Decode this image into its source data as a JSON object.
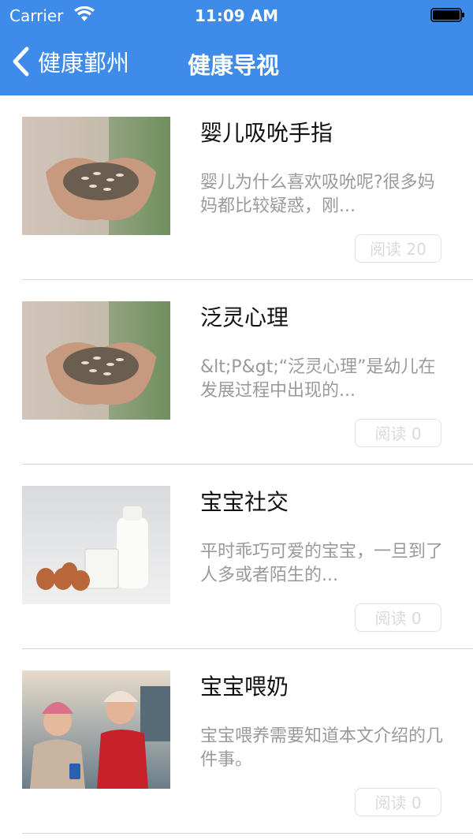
{
  "status_bar": {
    "carrier": "Carrier",
    "time": "11:09 AM"
  },
  "nav": {
    "back_label": "健康鄞州",
    "title": "健康导视"
  },
  "articles": [
    {
      "title": "婴儿吸吮手指",
      "summary": "婴儿为什么喜欢吸吮呢?很多妈妈都比较疑惑，刚...",
      "read_label": "阅读",
      "read_count": "20",
      "image": "seeds-in-hands"
    },
    {
      "title": "泛灵心理",
      "summary": "&lt;P&gt;“泛灵心理”是幼儿在发展过程中出现的...",
      "read_label": "阅读",
      "read_count": "0",
      "image": "seeds-in-hands"
    },
    {
      "title": "宝宝社交",
      "summary": "平时乖巧可爱的宝宝，一旦到了人多或者陌生的...",
      "read_label": "阅读",
      "read_count": "0",
      "image": "milk-and-eggs"
    },
    {
      "title": "宝宝喂奶",
      "summary": "宝宝喂养需要知道本文介绍的几件事。",
      "read_label": "阅读",
      "read_count": "0",
      "image": "two-women-winter"
    }
  ],
  "colors": {
    "nav_bar": "#3e8bea",
    "summary_text": "#9a9a9a",
    "read_button_text": "#dadada"
  }
}
